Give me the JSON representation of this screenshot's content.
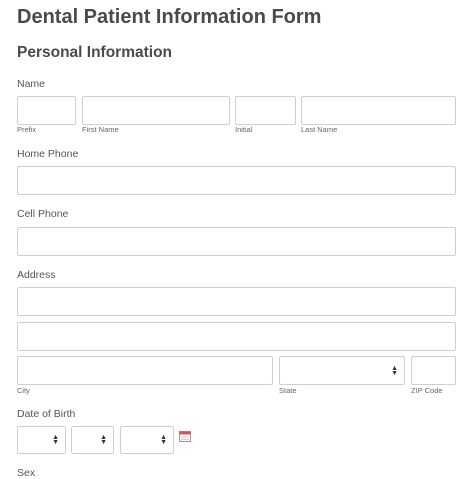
{
  "form": {
    "title": "Dental Patient Information Form",
    "section_title": "Personal Information",
    "name": {
      "label": "Name",
      "prefix_label": "Prefix",
      "first_label": "First Name",
      "initial_label": "Initial",
      "last_label": "Last Name"
    },
    "home_phone": {
      "label": "Home Phone"
    },
    "cell_phone": {
      "label": "Cell Phone"
    },
    "address": {
      "label": "Address",
      "city_label": "City",
      "state_label": "State",
      "zip_label": "ZIP Code"
    },
    "dob": {
      "label": "Date of Birth"
    },
    "next_label": "Sex"
  }
}
